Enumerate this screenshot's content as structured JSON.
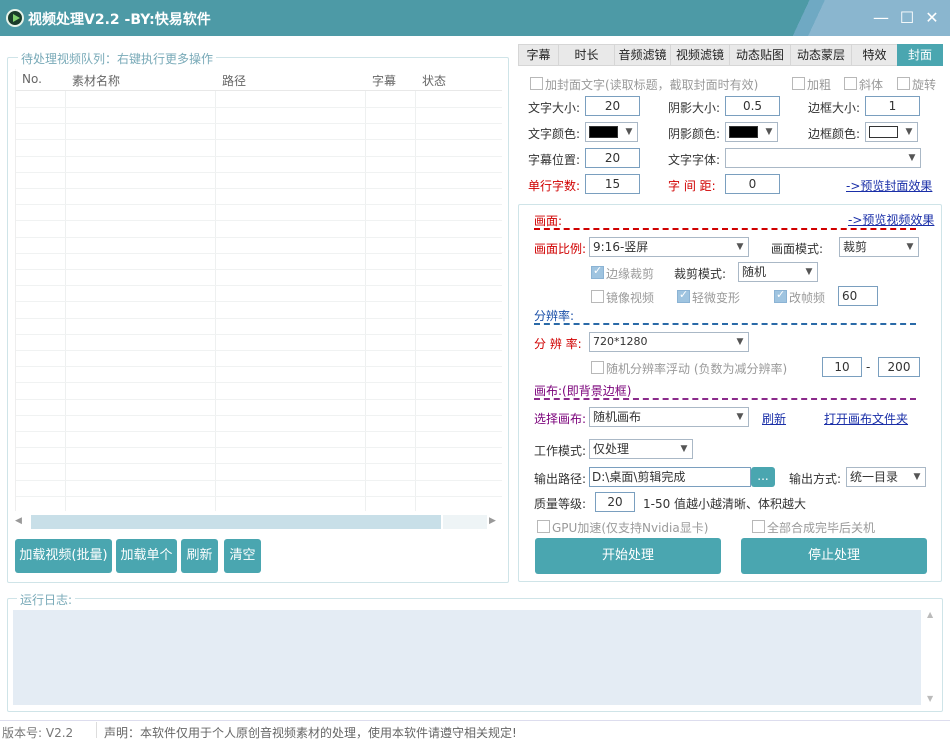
{
  "window": {
    "title": "视频处理V2.2 -BY:快易软件"
  },
  "queue": {
    "group_label": "待处理视频队列：右键执行更多操作",
    "columns": [
      "No.",
      "素材名称",
      "路径",
      "字幕",
      "状态"
    ],
    "buttons": {
      "load_batch": "加载视频(批量)",
      "load_single": "加载单个",
      "refresh": "刷新",
      "clear": "清空"
    }
  },
  "tabs": [
    {
      "label": "字幕"
    },
    {
      "label": "时长"
    },
    {
      "label": "音频滤镜"
    },
    {
      "label": "视频滤镜"
    },
    {
      "label": "动态贴图"
    },
    {
      "label": "动态蒙层"
    },
    {
      "label": "特效"
    },
    {
      "label": "封面"
    }
  ],
  "cover": {
    "add_text_label": "加封面文字(读取标题，截取封面时有效)",
    "bold": "加粗",
    "italic": "斜体",
    "rotate": "旋转",
    "font_size_label": "文字大小:",
    "font_size": "20",
    "shadow_size_label": "阴影大小:",
    "shadow_size": "0.5",
    "border_size_label": "边框大小:",
    "border_size": "1",
    "text_color_label": "文字颜色:",
    "shadow_color_label": "阴影颜色:",
    "border_color_label": "边框颜色:",
    "text_color": "#000000",
    "shadow_color": "#000000",
    "border_color": "#ffffff",
    "position_label": "字幕位置:",
    "position": "20",
    "font_label": "文字字体:",
    "font": "",
    "chars_per_line_label": "单行字数:",
    "chars_per_line": "15",
    "spacing_label": "字 间 距:",
    "spacing": "0",
    "preview_cover": "->预览封面效果"
  },
  "picture": {
    "section_label": "画面:",
    "preview_video": "->预览视频效果",
    "ratio_label": "画面比例:",
    "ratio": "9:16-竖屏",
    "mode_label": "画面模式:",
    "mode": "裁剪",
    "edge_crop": "边缘裁剪",
    "crop_mode_label": "裁剪模式:",
    "crop_mode": "随机",
    "mirror": "镜像视频",
    "slight_deform": "轻微变形",
    "change_fps": "改帧频",
    "fps": "60"
  },
  "resolution": {
    "section_label": "分辨率:",
    "label": "分 辨 率:",
    "value": "720*1280",
    "random_float": "随机分辨率浮动 (负数为减分辨率)",
    "float_min": "10",
    "float_dash": "-",
    "float_max": "200"
  },
  "canvas": {
    "section_label": "画布:(即背景边框)",
    "select_label": "选择画布:",
    "value": "随机画布",
    "refresh": "刷新",
    "open_folder": "打开画布文件夹"
  },
  "output": {
    "work_mode_label": "工作模式:",
    "work_mode": "仅处理",
    "path_label": "输出路径:",
    "path": "D:\\桌面\\剪辑完成",
    "browse": "...",
    "method_label": "输出方式:",
    "method": "统一目录",
    "quality_label": "质量等级:",
    "quality": "20",
    "quality_hint": "1-50 值越小越清晰、体积越大",
    "gpu": "GPU加速(仅支持Nvidia显卡)",
    "shutdown": "全部合成完毕后关机",
    "start": "开始处理",
    "stop": "停止处理"
  },
  "log": {
    "label": "运行日志:"
  },
  "status": {
    "version": "版本号: V2.2",
    "notice": "声明：本软件仅用于个人原创音视频素材的处理，使用本软件请遵守相关规定!"
  }
}
